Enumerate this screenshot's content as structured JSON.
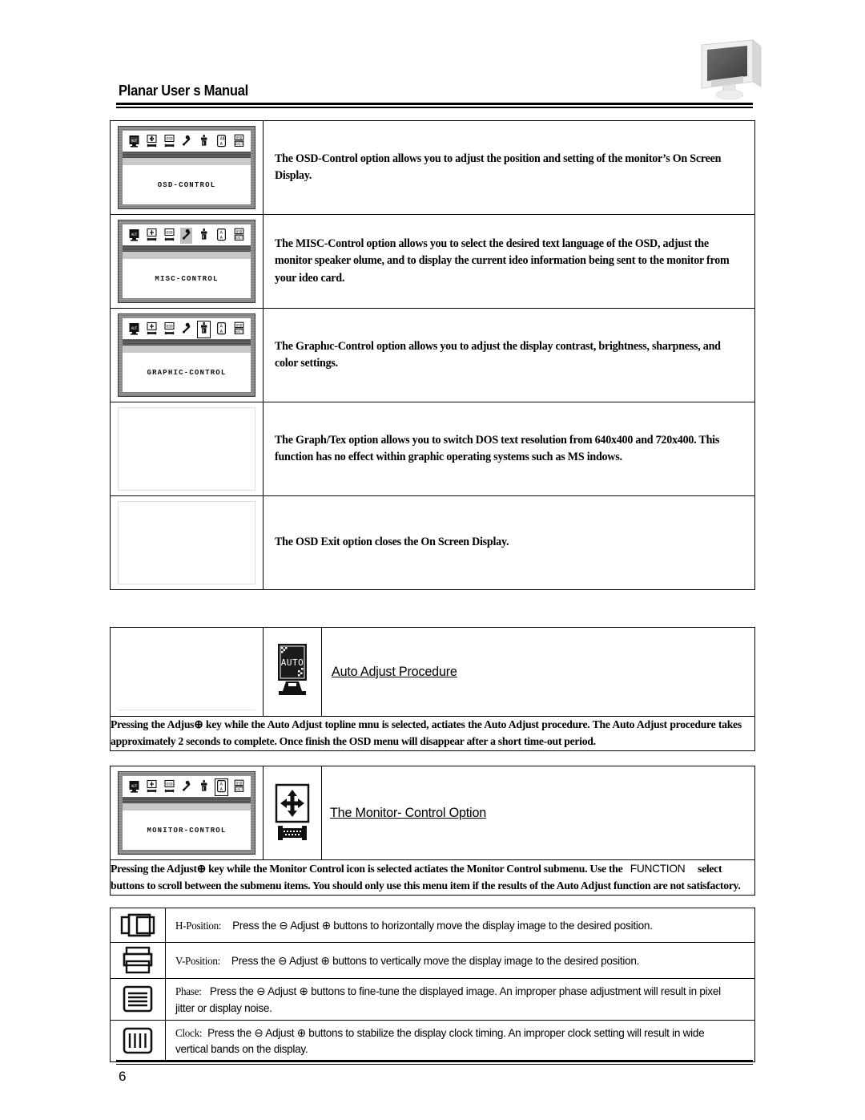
{
  "header": {
    "title": "Planar User s Manual",
    "monitor_icon": "lcd-monitor-illustration"
  },
  "footer": {
    "page_number": "6"
  },
  "options_table": {
    "rows": [
      {
        "osd_label": "OSD-CONTROL",
        "selected_icon_index": 5,
        "selection_style": "white",
        "highlight_row": 1,
        "description": "The OSD-Control option allows you to adjust the position and setting of the monitor’s On Screen Display."
      },
      {
        "osd_label": "MISC-CONTROL",
        "selected_icon_index": 3,
        "selection_style": "gray",
        "highlight_row": 1,
        "description": "The MISC-Control option allows you to select the desired text language of the OSD, adjust the monitor speaker olume, and to display the current ideo information being sent to the monitor from your ideo card."
      },
      {
        "osd_label": "GRAPHIC-CONTROL",
        "selected_icon_index": 4,
        "selection_style": "white",
        "highlight_row": 1,
        "description": "The Graphıc-Control option allows you to adjust the display contrast, brightness, sharpness, and color settings."
      },
      {
        "osd_label": "",
        "selected_icon_index": -1,
        "selection_style": "none",
        "highlight_row": 0,
        "description": "The Graph/Tex option allows you to switch DOS text resolution from 640x400 and 720x400.  This function has no effect within graphic operating systems such as MS indows."
      },
      {
        "osd_label": "",
        "selected_icon_index": -1,
        "selection_style": "none",
        "highlight_row": 0,
        "description": "The OSD Exit option closes the On Screen Display."
      }
    ],
    "icon_names": [
      "auto-monitor-icon",
      "h-v-position-icon",
      "osd-position-icon",
      "wrench-misc-icon",
      "graphic-contrast-icon",
      "language-a-a-icon",
      "osd-exit-icon"
    ]
  },
  "auto_adjust": {
    "icon": "auto-monitor-icon",
    "title": "Auto Adjust Procedure",
    "paragraph_part1": "Pressing the Adjus",
    "paragraph_plus": "⊕",
    "paragraph_part2": " key while the Auto Adjust topline mnu is selected, actiates the Auto Adjust procedure.  The Auto Adjust procedure takes approximately 2 seconds to complete.  Once finish the OSD menu will disappear after a short time-out period."
  },
  "monitor_control": {
    "osd_label": "MONITOR-CONTROL",
    "icon_primary": "four-way-arrow-icon",
    "icon_secondary": "horizontal-size-bone-icon",
    "title": "The Monitor- Control Option ",
    "paragraph_part1": "Pressing  the  Adjust",
    "paragraph_plus": "⊕",
    "paragraph_part2": " key  while  the  Monitor  Control  icon  is  selected actiates  the  Monitor  Control  submenu.   Use  the",
    "paragraph_function": "FUNCTION",
    "paragraph_part3": "select buttons to scroll between the submenu items.  You should only use this menu item if the results of the Auto Adjust function are not satisfactory."
  },
  "submenu_table": {
    "rows": [
      {
        "icon": "h-position-icon",
        "label": "H-Position:",
        "text_before": "Press the",
        "minus": "⊖",
        "adjust": "Adjust",
        "plus": "⊕",
        "text_after": "buttons to horizontally move the display image to the desired position."
      },
      {
        "icon": "v-position-icon",
        "label": "V-Position:",
        "text_before": "Press the",
        "minus": "⊖",
        "adjust": "Adjust",
        "plus": "⊕",
        "text_after": "buttons to vertically move the display image to the desired position."
      },
      {
        "icon": "phase-icon",
        "label": "Phase:",
        "text_before": "Press the",
        "minus": "⊖",
        "adjust": "Adjust",
        "plus": "⊕",
        "text_after": "buttons to fine-tune the displayed image.  An improper phase adjustment will result in pixel jitter or display noise."
      },
      {
        "icon": "clock-icon",
        "label": "Clock:",
        "text_before": "Press the",
        "minus": "⊖",
        "adjust": "Adjust",
        "plus": "⊕",
        "text_after": "buttons to stabilize the display clock timing.  An improper clock setting will result in wide vertical bands on the display."
      }
    ]
  },
  "colors": {
    "text": "#000000",
    "osd_frame": "#8a8a8a",
    "osd_highlight": "#c9c9c9",
    "osd_dark_band": "#555555"
  }
}
